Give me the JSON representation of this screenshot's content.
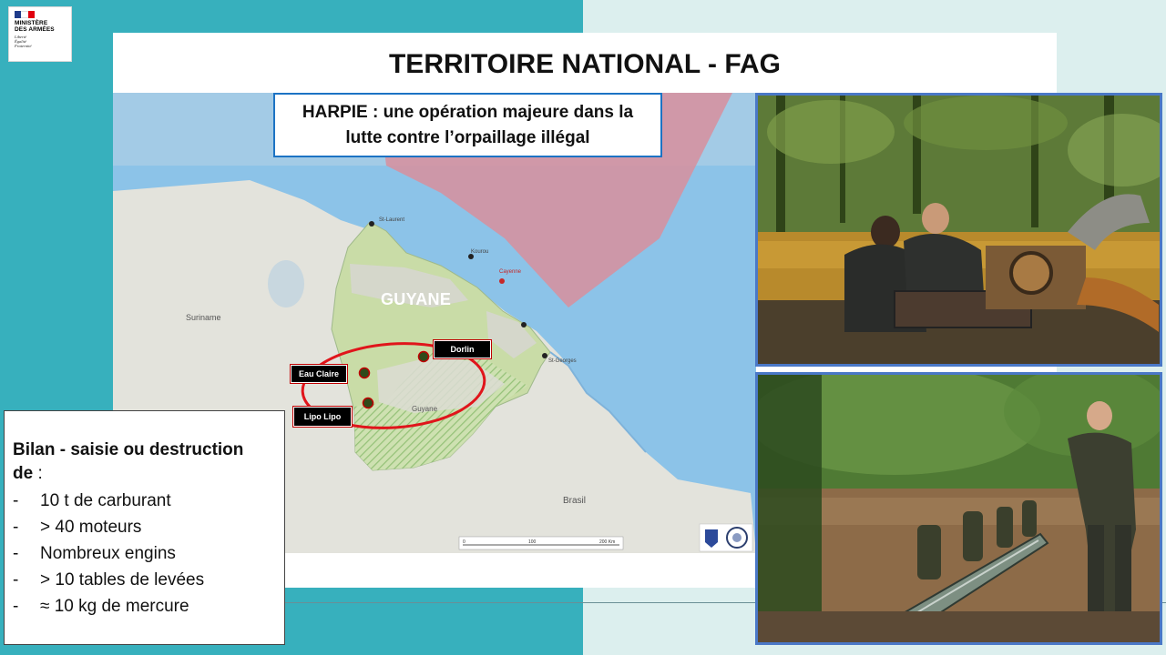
{
  "header": {
    "logo_lines": [
      "MINISTÈRE",
      "DES ARMÉES"
    ],
    "logo_motto": [
      "Liberté",
      "Égalité",
      "Fraternité"
    ],
    "title": "TERRITOIRE NATIONAL - FAG"
  },
  "caption": {
    "line1": "HARPIE : une opération majeure dans la",
    "line2": "lutte contre l’orpaillage illégal"
  },
  "map": {
    "region_label": "GUYANE",
    "neighbor_label": "Suriname",
    "country_label": "Brasil",
    "inner_label": "Guyane",
    "cities": [
      "St-Laurent",
      "Kourou",
      "Cayenne",
      "St-Georges"
    ],
    "sites": [
      "Dorlin",
      "Eau Claire",
      "Lipo Lipo"
    ],
    "scale_ticks": [
      "0",
      "100",
      "200 Km"
    ],
    "colors": {
      "ocean": "#8cc3e8",
      "land": "#e3e3dc",
      "guyane_land": "#c9dca7",
      "sea_zone": "#d88f9c",
      "circle": "#e0151b"
    }
  },
  "bilan": {
    "title": "Bilan - saisie ou destruction",
    "title_line2": "de",
    "title_colon": " :",
    "items": [
      "10 t de carburant",
      "> 40 moteurs",
      "Nombreux engins",
      "> 10 tables de levées",
      "≈ 10 kg de mercure"
    ]
  }
}
